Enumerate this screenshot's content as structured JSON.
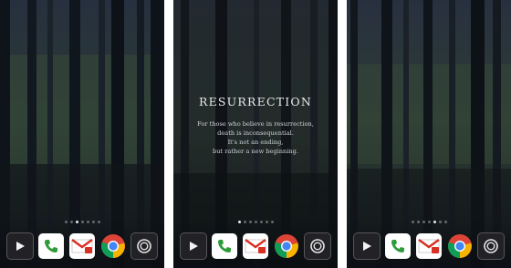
{
  "screens": [
    {
      "id": "left",
      "active_page": 2
    },
    {
      "id": "middle",
      "active_page": 0
    },
    {
      "id": "right",
      "active_page": 4
    }
  ],
  "page_count": 7,
  "quote": {
    "title": "RESURRECTION",
    "lines": [
      "For those who believe in resurrection,",
      "death is inconsequential.",
      "It's not an ending,",
      "but rather a new beginning."
    ]
  },
  "dock": [
    {
      "name": "play-store-icon"
    },
    {
      "name": "phone-icon"
    },
    {
      "name": "gmail-icon"
    },
    {
      "name": "chrome-icon"
    },
    {
      "name": "camera-icon"
    }
  ],
  "colors": {
    "forest_dark": "#141a24",
    "forest_mid": "#2b3a2e",
    "dock_dark": "#1e1e22",
    "phone_green": "#2e9c3a",
    "gmail_red": "#d93025",
    "chrome_red": "#db4437",
    "chrome_yellow": "#f4b400",
    "chrome_green": "#0f9d58",
    "chrome_blue": "#4285f4"
  }
}
